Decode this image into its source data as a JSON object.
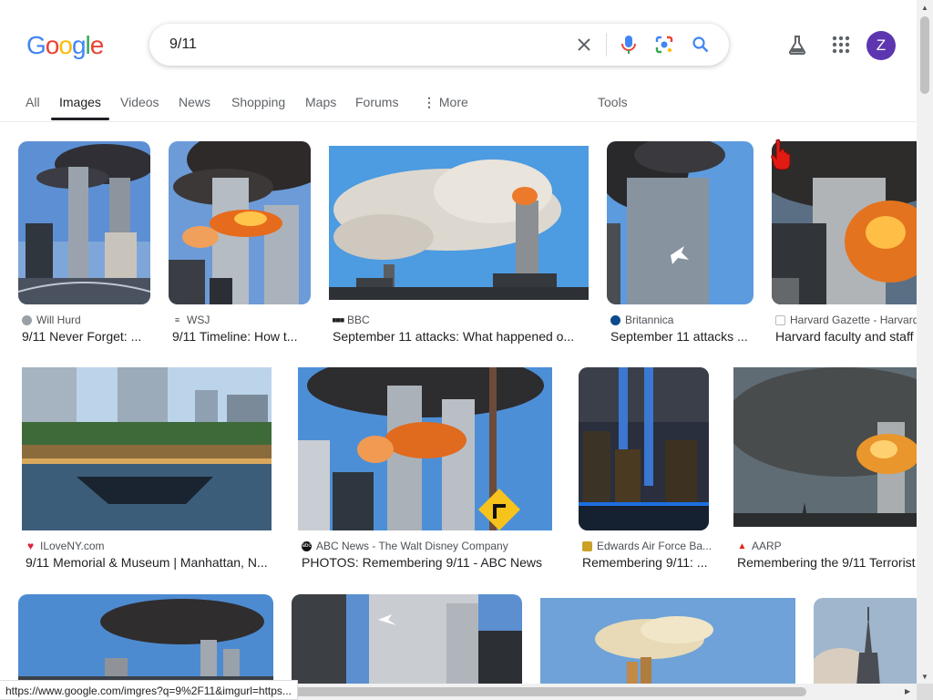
{
  "logo": {
    "text": "Google",
    "letters": [
      "G",
      "o",
      "o",
      "g",
      "l",
      "e"
    ],
    "colors": [
      "#4285f4",
      "#ea4335",
      "#fbbc05",
      "#4285f4",
      "#34a853",
      "#ea4335"
    ]
  },
  "search": {
    "query": "9/11",
    "placeholder": ""
  },
  "header_icons": [
    "close-icon",
    "microphone-icon",
    "lens-icon",
    "search-icon",
    "labs-flask-icon",
    "apps-grid-icon"
  ],
  "account": {
    "initial": "Z",
    "color": "#5e35b1"
  },
  "tabs": [
    "All",
    "Images",
    "Videos",
    "News",
    "Shopping",
    "Maps",
    "Forums",
    "More",
    "Tools"
  ],
  "active_tab": "Images",
  "results": [
    {
      "source": "Will Hurd",
      "title": "9/11 Never Forget: ...",
      "favicon_color": "#9aa0a6"
    },
    {
      "source": "WSJ",
      "title": "9/11 Timeline: How t...",
      "favicon_color": "#444444"
    },
    {
      "source": "BBC",
      "title": "September 11 attacks: What happened o...",
      "favicon_color": "#222222"
    },
    {
      "source": "Britannica",
      "title": "September 11 attacks ...",
      "favicon_color": "#0b4a8b"
    },
    {
      "source": "Harvard Gazette - Harvard",
      "title": "Harvard faculty and staff",
      "favicon_color": "#ffffff"
    },
    {
      "source": "ILoveNY.com",
      "title": "9/11 Memorial & Museum | Manhattan, N...",
      "favicon_color": "#d7263d"
    },
    {
      "source": "ABC News - The Walt Disney Company",
      "title": "PHOTOS: Remembering 9/11 - ABC News",
      "favicon_color": "#111111"
    },
    {
      "source": "Edwards Air Force Ba...",
      "title": "Remembering 9/11: ...",
      "favicon_color": "#c9a227"
    },
    {
      "source": "AARP",
      "title": "Remembering the 9/11 Terrorist",
      "favicon_color": "#e2231a"
    }
  ],
  "status_bar": {
    "url": "https://www.google.com/imgres?q=9%2F11&imgurl=https..."
  }
}
